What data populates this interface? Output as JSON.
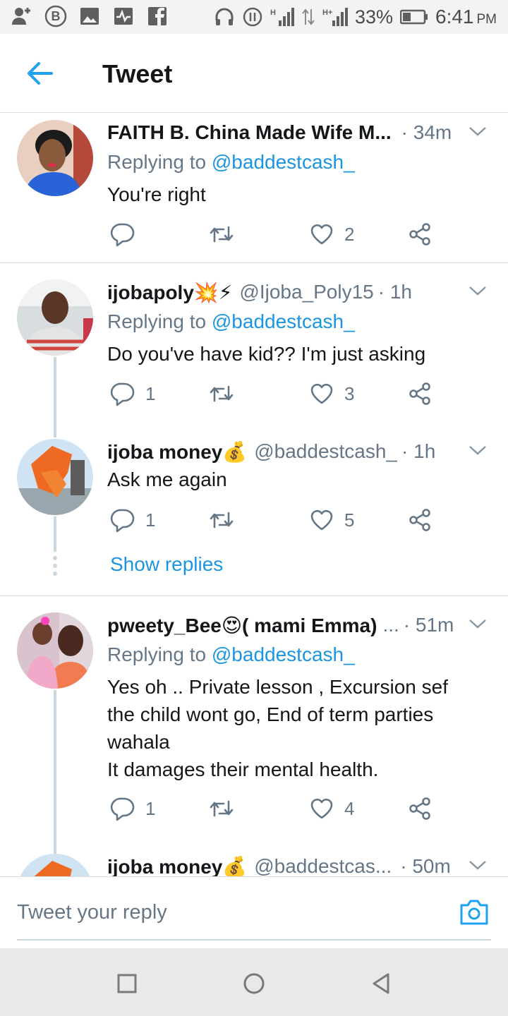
{
  "status_bar": {
    "battery_percent": "33%",
    "time": "6:41",
    "time_suffix": "PM"
  },
  "header": {
    "title": "Tweet"
  },
  "tweets": [
    {
      "name": "FAITH B. China Made Wife M...",
      "handle": "",
      "time": "· 34m",
      "replying_prefix": "Replying to ",
      "replying_to": "@baddestcash_",
      "text": "You're right",
      "reply_count": "",
      "retweet_count": "",
      "like_count": "2"
    },
    {
      "name": "ijobapoly💥⚡",
      "handle": "@Ijoba_Poly15",
      "time": "· 1h",
      "replying_prefix": "Replying to ",
      "replying_to": "@baddestcash_",
      "text": "Do you've have kid??  I'm just asking",
      "reply_count": "1",
      "retweet_count": "",
      "like_count": "3"
    },
    {
      "name": "ijoba money💰",
      "handle": "@baddestcash_",
      "time": "· 1h",
      "text": "Ask me again",
      "reply_count": "1",
      "retweet_count": "",
      "like_count": "5",
      "show_replies": "Show replies"
    },
    {
      "name": "pweety_Bee😍( mami Emma)",
      "handle": "...",
      "time": "· 51m",
      "replying_prefix": "Replying to ",
      "replying_to": "@baddestcash_",
      "text": "Yes oh .. Private lesson , Excursion sef\nthe child wont go, End of term parties\nwahala\nIt damages their mental health.",
      "reply_count": "1",
      "retweet_count": "",
      "like_count": "4"
    },
    {
      "name": "ijoba money💰",
      "handle": "@baddestcas...",
      "time": "· 50m"
    }
  ],
  "compose": {
    "placeholder": "Tweet your reply"
  },
  "icons": {
    "back": "arrow-left-icon",
    "reply": "reply-bubble-icon",
    "retweet": "retweet-icon",
    "like": "heart-icon",
    "share": "share-icon",
    "caret": "chevron-down-icon",
    "camera": "camera-icon"
  },
  "colors": {
    "accent": "#1da1f2",
    "link": "#1b95e0",
    "muted": "#657786",
    "text": "#14171a",
    "divider": "#d9dee2"
  }
}
